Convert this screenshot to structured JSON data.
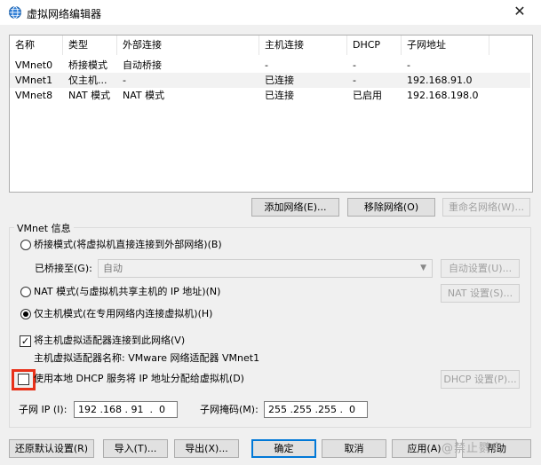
{
  "window": {
    "title": "虚拟网络编辑器",
    "close": "✕"
  },
  "table": {
    "columns": [
      "名称",
      "类型",
      "外部连接",
      "主机连接",
      "DHCP",
      "子网地址"
    ],
    "rows": [
      [
        "VMnet0",
        "桥接模式",
        "自动桥接",
        "-",
        "-",
        "-"
      ],
      [
        "VMnet1",
        "仅主机...",
        "-",
        "已连接",
        "-",
        "192.168.91.0"
      ],
      [
        "VMnet8",
        "NAT 模式",
        "NAT 模式",
        "已连接",
        "已启用",
        "192.168.198.0"
      ]
    ]
  },
  "net_buttons": {
    "add": "添加网络(E)...",
    "remove": "移除网络(O)",
    "rename": "重命名网络(W)..."
  },
  "vmnet_info": {
    "label": "VMnet 信息",
    "bridged_label": "桥接模式(将虚拟机直接连接到外部网络)(B)",
    "bridged_to_label": "已桥接至(G):",
    "bridged_to_value": "自动",
    "auto_settings": "自动设置(U)...",
    "nat_label": "NAT 模式(与虚拟机共享主机的 IP 地址)(N)",
    "nat_settings": "NAT 设置(S)...",
    "hostonly_label": "仅主机模式(在专用网络内连接虚拟机)(H)",
    "connect_adapter_label": "将主机虚拟适配器连接到此网络(V)",
    "adapter_name_label": "主机虚拟适配器名称: VMware 网络适配器 VMnet1",
    "dhcp_label": "使用本地 DHCP 服务将 IP 地址分配给虚拟机(D)",
    "dhcp_settings": "DHCP 设置(P)...",
    "subnet_ip_label": "子网 IP (I):",
    "subnet_ip_value": "192 .168 . 91  .  0",
    "subnet_mask_label": "子网掩码(M):",
    "subnet_mask_value": "255 .255 .255 .  0"
  },
  "selected_mode": "host-only",
  "connect_adapter_checked": true,
  "dhcp_checked": false,
  "bottom_buttons": {
    "restore": "还原默认设置(R)",
    "import": "导入(T)...",
    "export": "导出(X)...",
    "ok": "确定",
    "cancel": "取消",
    "apply": "应用(A)",
    "help": "帮助"
  },
  "watermark": "@禁止鹦鸟",
  "colors": {
    "accent": "#0078d7",
    "highlight": "#e8311a"
  }
}
